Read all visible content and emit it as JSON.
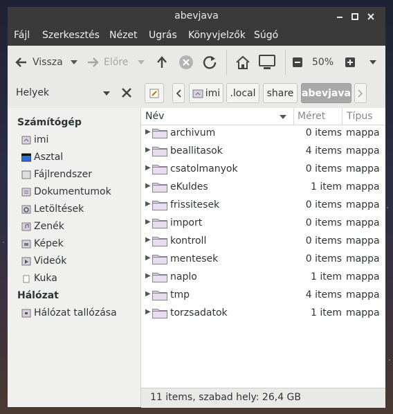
{
  "window": {
    "title": "abevjava"
  },
  "menubar": [
    "Fájl",
    "Szerkesztés",
    "Nézet",
    "Ugrás",
    "Könyvjelzők",
    "Súgó"
  ],
  "toolbar": {
    "back": "Vissza",
    "forward": "Előre",
    "zoom": "50%"
  },
  "sidebar": {
    "selector": "Helyek",
    "section_computer": "Számítógép",
    "computer_items": [
      "imi",
      "Asztal",
      "Fájlrendszer",
      "Dokumentumok",
      "Letöltések",
      "Zenék",
      "Képek",
      "Videók",
      "Kuka"
    ],
    "section_network": "Hálózat",
    "network_items": [
      "Hálózat tallózása"
    ]
  },
  "path": [
    "imi",
    ".local",
    "share",
    "abevjava"
  ],
  "columns": {
    "name": "Név",
    "size": "Méret",
    "type": "Típus"
  },
  "files": [
    {
      "name": "archivum",
      "size": "0 items",
      "type": "mappa"
    },
    {
      "name": "beallitasok",
      "size": "4 items",
      "type": "mappa"
    },
    {
      "name": "csatolmanyok",
      "size": "0 items",
      "type": "mappa"
    },
    {
      "name": "eKuldes",
      "size": "1 item",
      "type": "mappa"
    },
    {
      "name": "frissitesek",
      "size": "0 items",
      "type": "mappa"
    },
    {
      "name": "import",
      "size": "0 items",
      "type": "mappa"
    },
    {
      "name": "kontroll",
      "size": "0 items",
      "type": "mappa"
    },
    {
      "name": "mentesek",
      "size": "0 items",
      "type": "mappa"
    },
    {
      "name": "naplo",
      "size": "1 item",
      "type": "mappa"
    },
    {
      "name": "tmp",
      "size": "4 items",
      "type": "mappa"
    },
    {
      "name": "torzsadatok",
      "size": "1 item",
      "type": "mappa"
    }
  ],
  "status": "11 items, szabad hely: 26,4 GB"
}
